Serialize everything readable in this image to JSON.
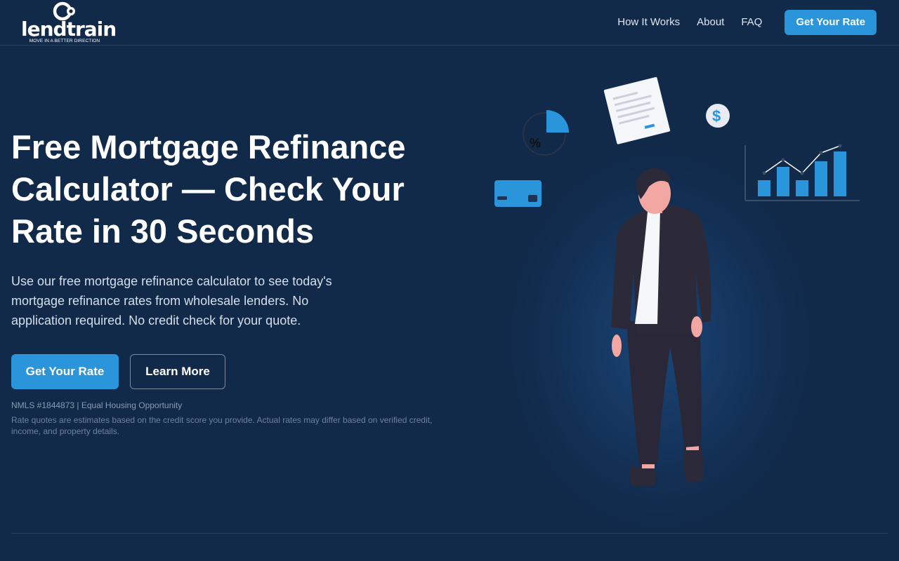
{
  "brand": {
    "name": "lendtrain",
    "tagline": "MOVE IN A BETTER DIRECTION"
  },
  "nav": {
    "links": [
      "How It Works",
      "About",
      "FAQ"
    ],
    "cta_label": "Get Your Rate"
  },
  "hero": {
    "title": "Free Mortgage Refinance Calculator — Check Your Rate in 30 Seconds",
    "subtitle": "Use our free mortgage refinance calculator to see today's mortgage refinance rates from wholesale lenders. No application required. No credit check for your quote.",
    "primary_button": "Get Your Rate",
    "secondary_button": "Learn More",
    "nmls": "NMLS #1844873 | Equal Housing Opportunity",
    "disclaimer": "Rate quotes are estimates based on the credit score you provide. Actual rates may differ based on verified credit, income, and property details."
  },
  "illustration": {
    "percent_symbol": "%",
    "dollar_symbol": "$",
    "icons": [
      "pie-chart-icon",
      "document-icon",
      "dollar-coin-icon",
      "credit-card-icon",
      "bar-chart-icon",
      "businessman-figure"
    ]
  },
  "colors": {
    "background": "#112a4a",
    "accent": "#2b95dc",
    "text": "#ffffff"
  }
}
